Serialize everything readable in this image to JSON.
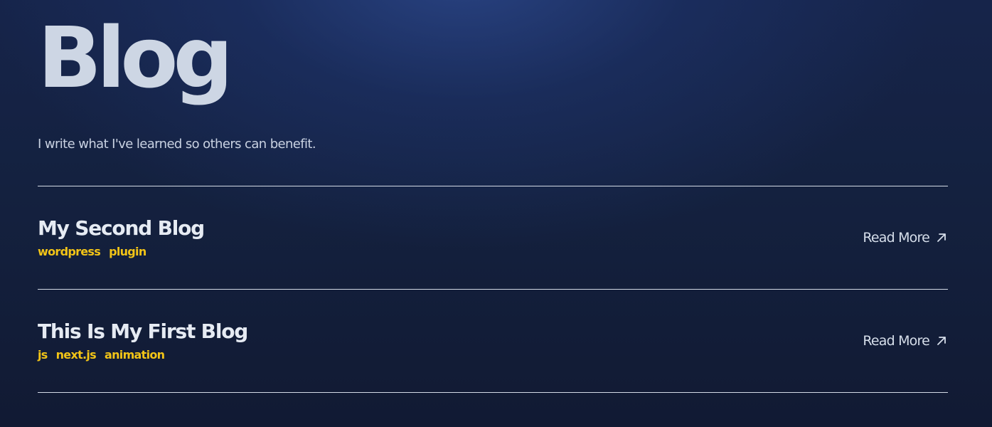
{
  "header": {
    "title": "Blog",
    "subtitle": "I write what I've learned so others can benefit."
  },
  "posts": [
    {
      "title": "My Second Blog",
      "tags": [
        "wordpress",
        "plugin"
      ],
      "read_more_label": "Read More",
      "icon": "arrow-up-right-icon"
    },
    {
      "title": "This Is My First Blog",
      "tags": [
        "js",
        "next.js",
        "animation"
      ],
      "read_more_label": "Read More",
      "icon": "arrow-up-right-icon"
    }
  ],
  "colors": {
    "background": "#14213f",
    "title_text": "#cdd6e4",
    "tag_text": "#f2c417",
    "divider": "#d4dbe6"
  }
}
